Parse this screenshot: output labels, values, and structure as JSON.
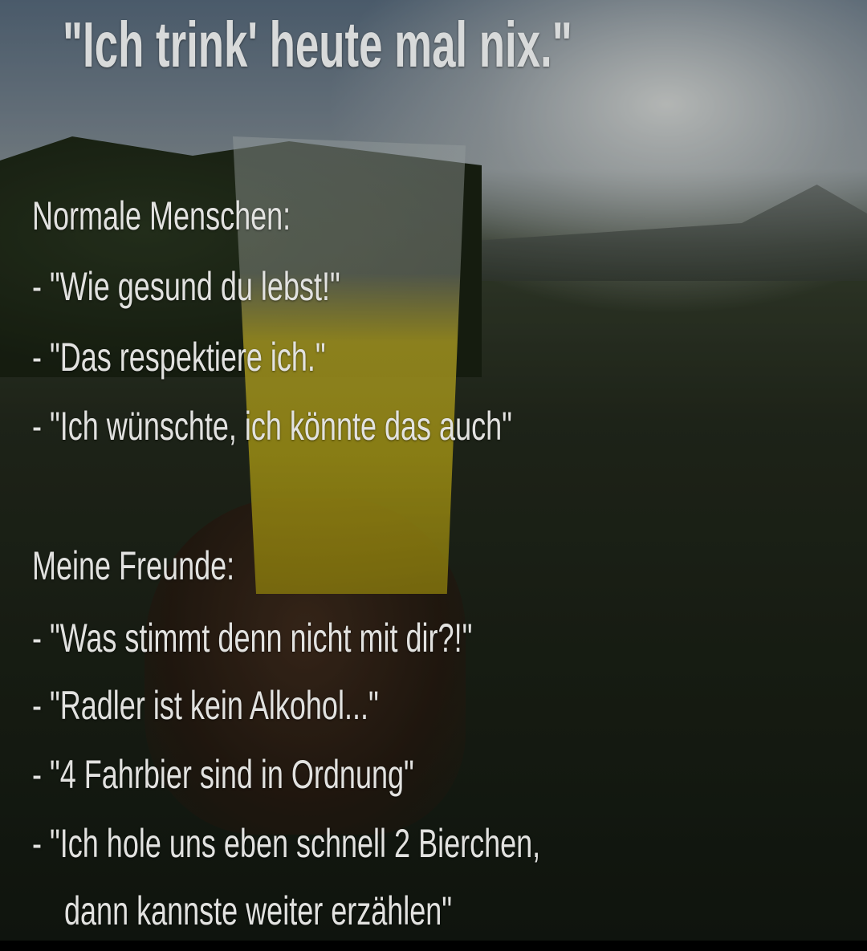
{
  "title": "\"Ich trink' heute mal nix.\"",
  "sections": [
    {
      "heading": "Normale Menschen:",
      "lines": [
        "- \"Wie gesund du lebst!\"",
        "- \"Das respektiere ich.\"",
        "- \"Ich wünschte, ich könnte das auch\""
      ]
    },
    {
      "heading": "Meine Freunde:",
      "lines": [
        "- \"Was stimmt denn nicht mit dir?!\"",
        "- \"Radler ist kein Alkohol...\"",
        "- \"4 Fahrbier sind in Ordnung\"",
        "- \"Ich hole uns eben schnell 2 Bierchen,",
        "dann kannste weiter erzählen\""
      ]
    }
  ]
}
